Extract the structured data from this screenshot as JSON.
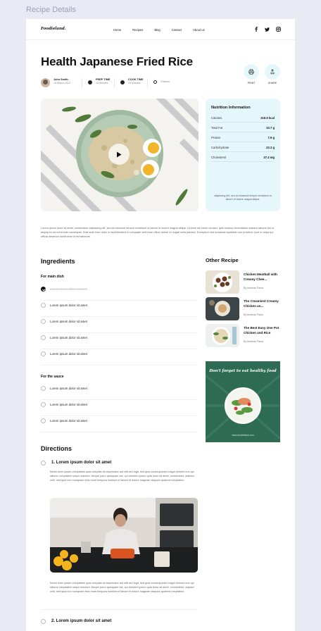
{
  "frame_label": "Recipe Details",
  "nav": {
    "logo": "Foodieland.",
    "menu": [
      "Home",
      "Recipes",
      "Blog",
      "Contact",
      "About us"
    ]
  },
  "recipe": {
    "title": "Health Japanese Fried Rice",
    "author": "John Smith",
    "date": "15 March 2022",
    "prep_label": "PREP TIME",
    "prep_value": "15 Minutes",
    "cook_label": "COOK TIME",
    "cook_value": "15 Minutes",
    "category": "Chicken",
    "actions": {
      "print": "PRINT",
      "share": "SHARE"
    }
  },
  "nutrition": {
    "title": "Nutrition Information",
    "rows": [
      {
        "label": "Calories",
        "value": "219.9 kcal"
      },
      {
        "label": "Total Fat",
        "value": "10.7 g"
      },
      {
        "label": "Protein",
        "value": "7.9 g"
      },
      {
        "label": "Carbohydrate",
        "value": "22.3 g"
      },
      {
        "label": "Cholesterol",
        "value": "37.4 mg"
      }
    ],
    "note": "adipiscing elit, sed do eiusmod tempor incididunt ut labore et dolore magna aliqua."
  },
  "description": "Lorem ipsum dolor sit amet, consectetur adipiscing elit, sed do eiusmod tempor incididunt ut labore et dolore magna aliqua. Ut enim ad minim veniam, quis nostrud exercitation ullamco laboris nisi ut aliquip ex ea commodo consequat. Duis aute irure dolor in reprehenderit in voluptate velit esse cillum dolore eu fugiat nulla pariatur. Excepteur sint occaecat cupidatat non proident, sunt in culpa qui officia deserunt mollit anim id est laborum.",
  "ingredients": {
    "title": "Ingredients",
    "main_title": "For main dish",
    "main_items": [
      {
        "text": "Lorem ipsum dolor sit amet",
        "done": true
      },
      {
        "text": "Lorem ipsum dolor sit amet",
        "done": false
      },
      {
        "text": "Lorem ipsum dolor sit amet",
        "done": false
      },
      {
        "text": "Lorem ipsum dolor sit amet",
        "done": false
      },
      {
        "text": "Lorem ipsum dolor sit amet",
        "done": false
      }
    ],
    "sauce_title": "For the sauce",
    "sauce_items": [
      {
        "text": "Lorem ipsum dolor sit amet",
        "done": false
      },
      {
        "text": "Lorem ipsum dolor sit amet",
        "done": false
      },
      {
        "text": "Lorem ipsum dolor sit amet",
        "done": false
      }
    ]
  },
  "other": {
    "title": "Other Recipe",
    "items": [
      {
        "title": "Chicken Meatball with Creamy Chee...",
        "author": "By Andreas Paula"
      },
      {
        "title": "The Creamiest Creamy Chicken an...",
        "author": "By Andreas Paula"
      },
      {
        "title": "The Best Easy One Pot Chicken and Rice",
        "author": "By Andreas Paula"
      }
    ],
    "promo_title": "Don't forget to eat healthy food",
    "promo_url": "www.foodieland.com"
  },
  "directions": {
    "title": "Directions",
    "steps": [
      {
        "title": "1. Lorem ipsum dolor sit amet",
        "text": "Nemo enim ipsam voluptatem quia voluptas sit aspernatur aut odit aut fugit, sed quia consequuntur magni dolores eos qui ratione voluptatem sequi nesciunt. Neque porro quisquam est, qui dolorem ipsum quia dolor sit amet, consectetur, adipisci velit, sed quia non numquam eius modi tempora incidunt ut labore et dolore magnam aliquam quaerat voluptatem.",
        "text2": "Nemo enim ipsam voluptatem quia voluptas sit aspernatur aut odit aut fugit, sed quia consequuntur magni dolores eos qui ratione voluptatem sequi nesciunt. Neque porro quisquam est, qui dolorem ipsum quia dolor sit amet, consectetur, adipisci velit, sed quia non numquam eius modi tempora incidunt ut labore et dolore magnam aliquam quaerat voluptatem."
      },
      {
        "title": "2. Lorem ipsum dolor sit amet"
      }
    ]
  }
}
